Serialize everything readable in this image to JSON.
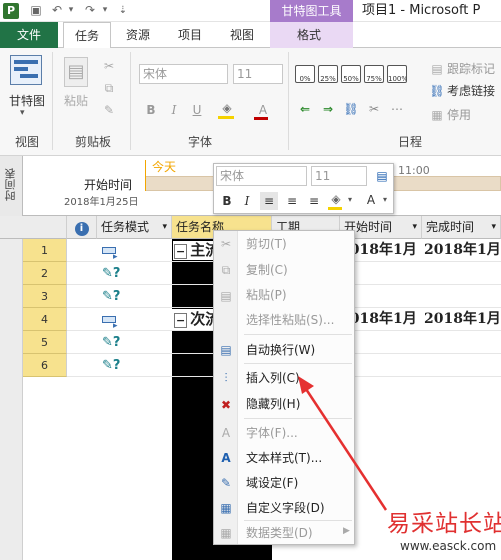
{
  "app": {
    "logo": "P",
    "window_title": "项目1 - Microsoft P",
    "contextual_group": "甘特图工具"
  },
  "tabs": [
    "文件",
    "任务",
    "资源",
    "项目",
    "视图",
    "格式"
  ],
  "ribbon": {
    "groups": {
      "view": "视图",
      "clipboard": "剪贴板",
      "font": "字体",
      "schedule": "日程"
    },
    "gantt_button": "甘特图",
    "paste_button": "粘贴",
    "font_name": "宋体",
    "font_size": "11",
    "pct_buttons": [
      "0%",
      "25%",
      "50%",
      "75%",
      "100%"
    ],
    "schedule_items": [
      "跟踪标记",
      "考虑链接",
      "停用"
    ]
  },
  "timeline": {
    "side_label": "时间表",
    "today": "今天",
    "start_label": "开始时间",
    "start_date": "2018年1月25日",
    "time_tick": "11:00"
  },
  "grid": {
    "headers": [
      "任务模式",
      "任务名称",
      "工期",
      "开始时间",
      "完成时间"
    ],
    "rows": [
      {
        "num": "1",
        "mode": "auto",
        "name": "主流",
        "start": "2018年1月",
        "finish": "2018年1月"
      },
      {
        "num": "2",
        "mode": "manual",
        "name": "",
        "start": "",
        "finish": ""
      },
      {
        "num": "3",
        "mode": "manual",
        "name": "",
        "start": "",
        "finish": ""
      },
      {
        "num": "4",
        "mode": "auto",
        "name": "次流",
        "start": "2018年1月",
        "finish": "2018年1月"
      },
      {
        "num": "5",
        "mode": "manual",
        "name": "",
        "start": "",
        "finish": ""
      },
      {
        "num": "6",
        "mode": "manual",
        "name": "",
        "start": "",
        "finish": ""
      }
    ]
  },
  "minibar": {
    "font_name": "宋体",
    "font_size": "11"
  },
  "context_menu": {
    "cut": "剪切(T)",
    "copy": "复制(C)",
    "paste": "粘贴(P)",
    "paste_special": "选择性粘贴(S)...",
    "wrap_text": "自动换行(W)",
    "insert_column": "插入列(C)",
    "hide_column": "隐藏列(H)",
    "font": "字体(F)...",
    "text_styles": "文本样式(T)...",
    "field_settings": "域设定(F)",
    "custom_fields": "自定义字段(D)",
    "data_type": "数据类型(D)"
  },
  "watermark": {
    "text": "易采站长站",
    "url": "www.easck.com"
  },
  "colors": {
    "file_tab": "#217346",
    "contextual": "#a77bcb",
    "row_num_bg": "#f7e28e",
    "arrow": "#e53030"
  }
}
